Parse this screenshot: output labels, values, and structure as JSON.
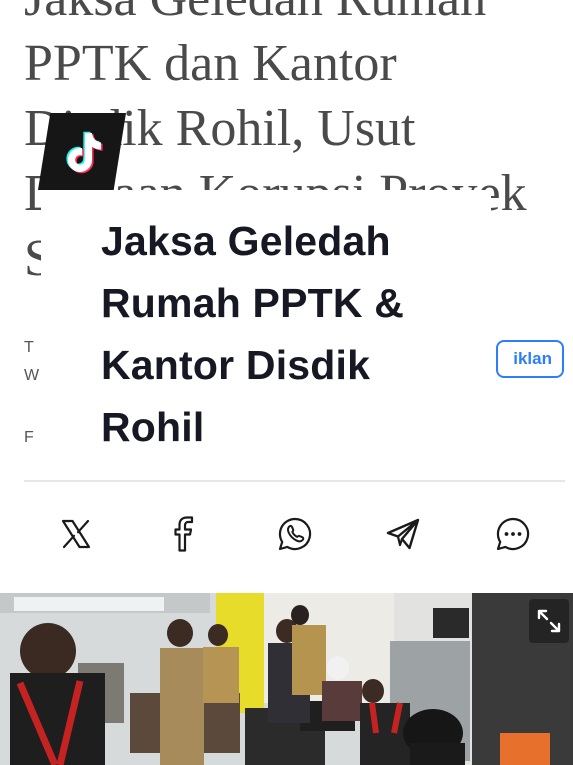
{
  "article": {
    "title_lines": [
      "Jaksa Geledah Rumah",
      "PPTK dan Kantor",
      "Disdik Rohil, Usut",
      "Dugaan Korupsi Proyek",
      "S"
    ],
    "meta_line_1": "T",
    "meta_line_2": "W",
    "meta_line_3": "F",
    "ad_label": "iklan"
  },
  "overlay": {
    "headline": "Jaksa Geledah Rumah PPTK & Kantor Disdik Rohil",
    "badge_icon": "tiktok-logo-icon"
  },
  "share": {
    "items": [
      {
        "name": "x",
        "icon": "x-logo-icon"
      },
      {
        "name": "facebook",
        "icon": "facebook-logo-icon"
      },
      {
        "name": "whatsapp",
        "icon": "whatsapp-logo-icon"
      },
      {
        "name": "telegram",
        "icon": "telegram-logo-icon"
      },
      {
        "name": "more",
        "icon": "chat-more-icon"
      }
    ]
  },
  "photo": {
    "icon": "expand-icon"
  },
  "colors": {
    "accent": "#2d7ff9",
    "headline": "#161823",
    "badge": "#161616"
  }
}
